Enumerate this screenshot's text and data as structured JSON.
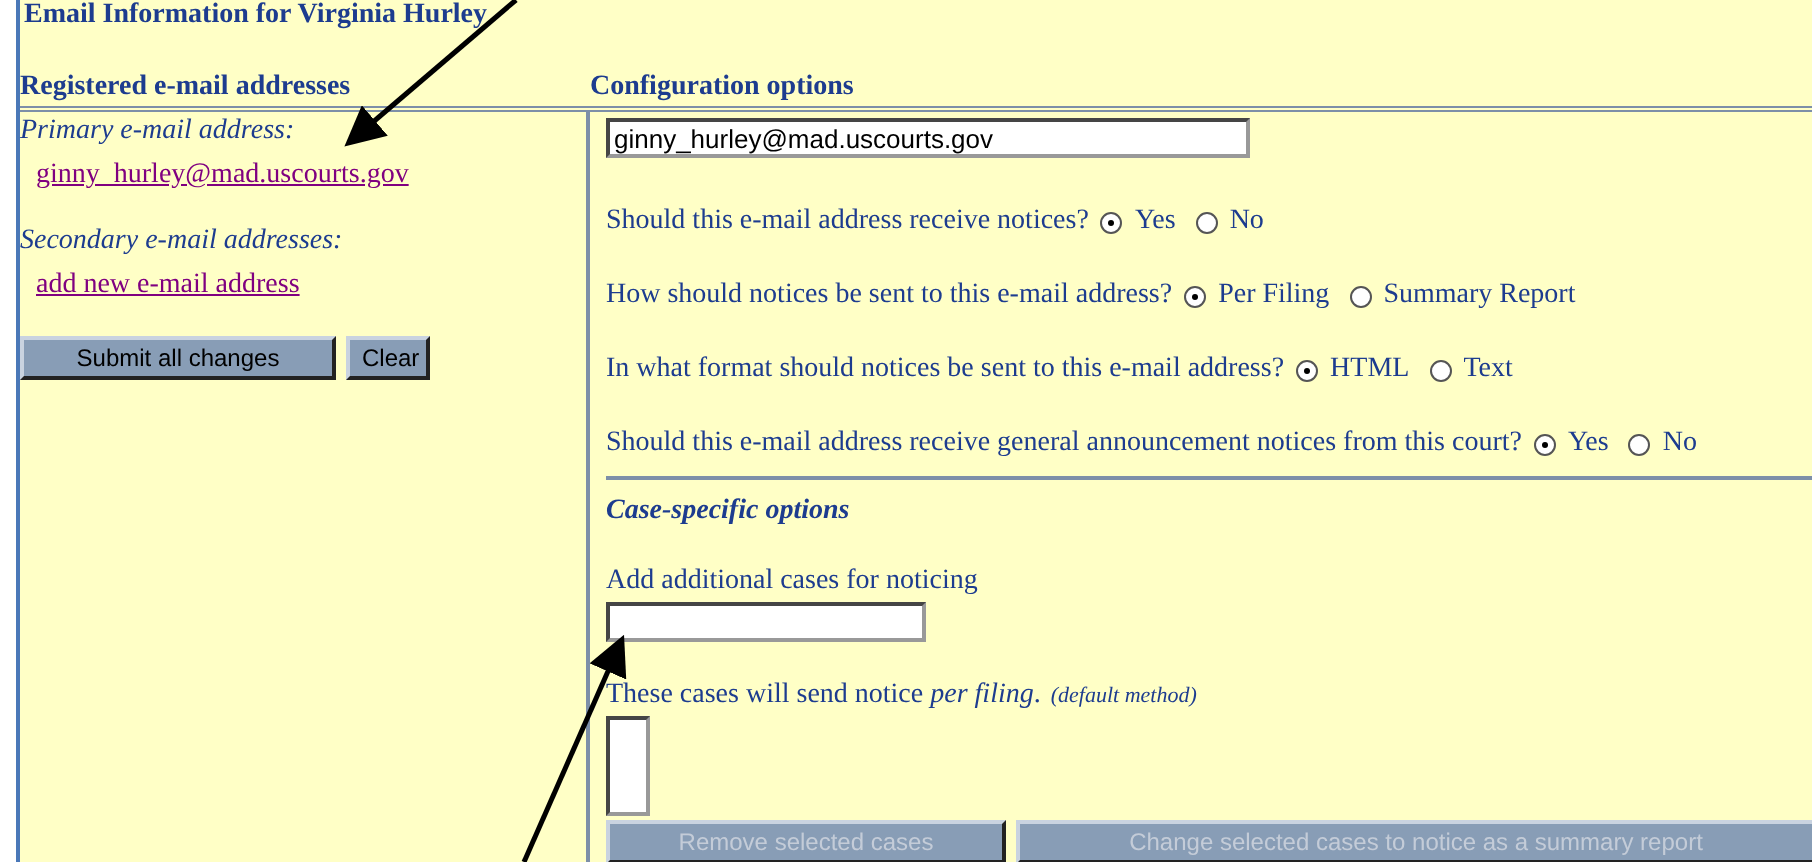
{
  "title": "Email Information for Virginia Hurley",
  "registered": {
    "heading": "Registered e-mail addresses",
    "primary_label": "Primary e-mail address:",
    "primary_link": "ginny_hurley@mad.uscourts.gov",
    "secondary_label": "Secondary e-mail addresses:",
    "add_link": "add new e-mail address"
  },
  "actions": [
    {
      "label": "Submit all changes",
      "kind": "primary"
    },
    {
      "label": "Clear",
      "kind": "secondary"
    }
  ],
  "config": {
    "heading": "Configuration options",
    "email_value": "ginny_hurley@mad.uscourts.gov",
    "questions": [
      {
        "text": "Should this e-mail address receive notices?",
        "options": [
          {
            "label": "Yes",
            "selected": true
          },
          {
            "label": "No",
            "selected": false
          }
        ]
      },
      {
        "text": "How should notices be sent to this e-mail address?",
        "options": [
          {
            "label": "Per Filing",
            "selected": true
          },
          {
            "label": "Summary Report",
            "selected": false
          }
        ]
      },
      {
        "text": "In what format should notices be sent to this e-mail address?",
        "options": [
          {
            "label": "HTML",
            "selected": true
          },
          {
            "label": "Text",
            "selected": false
          }
        ]
      },
      {
        "text": "Should this e-mail address receive general announcement notices from this court?",
        "options": [
          {
            "label": "Yes",
            "selected": true
          },
          {
            "label": "No",
            "selected": false
          }
        ]
      }
    ]
  },
  "case_options": {
    "heading": "Case-specific options",
    "add_label": "Add additional cases for noticing",
    "list_label": "These cases will send notice *per filing*.",
    "list_note": "(default method)",
    "buttons": [
      {
        "label": "Remove selected cases",
        "disabled": true
      },
      {
        "label": "Change selected cases to notice as a summary report",
        "disabled": true
      }
    ]
  }
}
